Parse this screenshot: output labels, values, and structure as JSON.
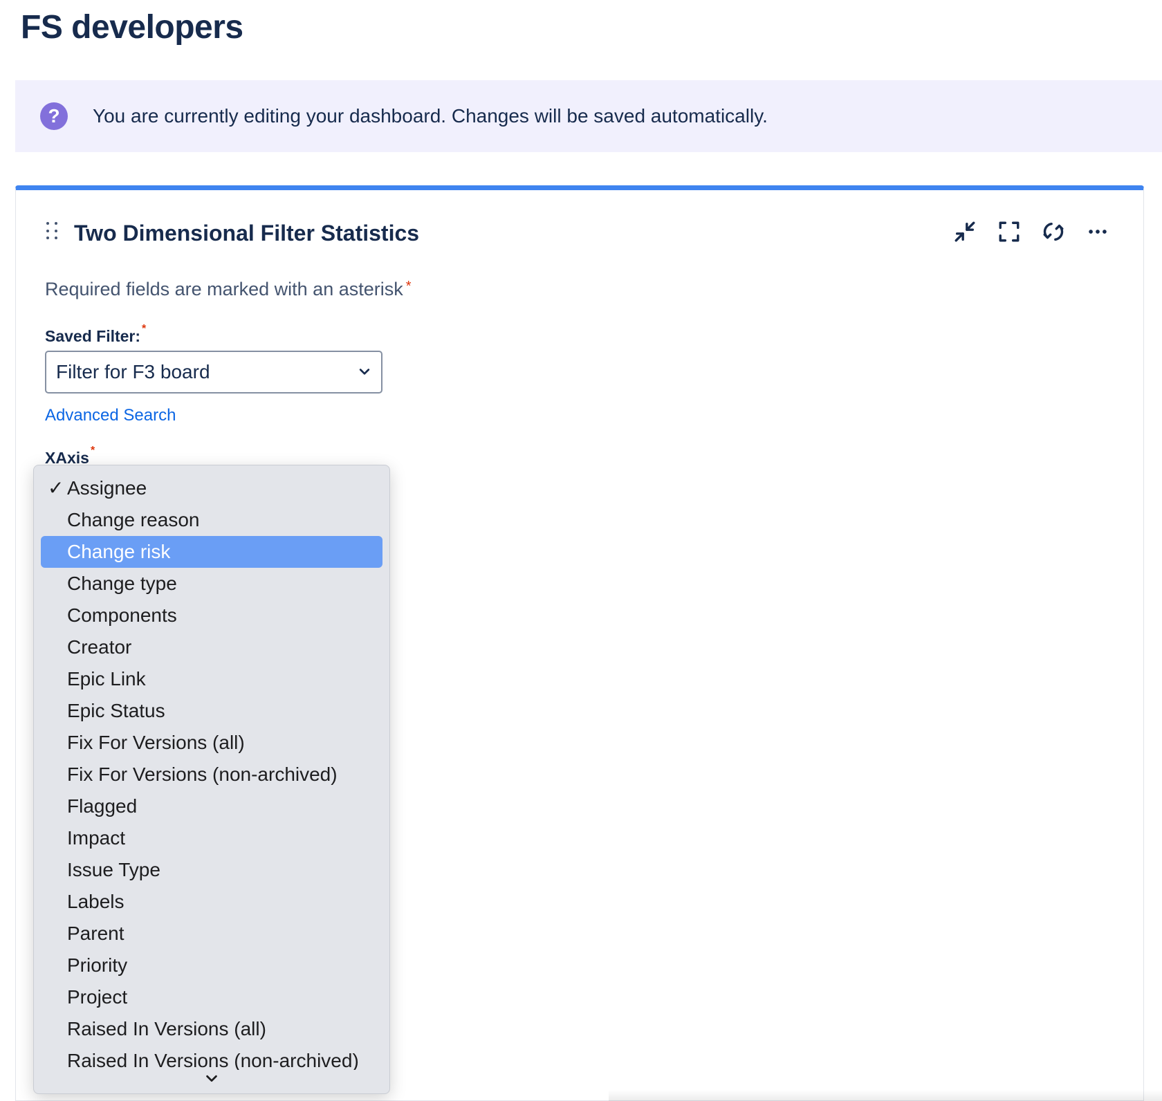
{
  "page": {
    "title": "FS developers"
  },
  "banner": {
    "icon": "question-icon",
    "icon_glyph": "?",
    "text": "You are currently editing your dashboard. Changes will be saved automatically."
  },
  "gadget": {
    "title": "Two Dimensional Filter Statistics",
    "actions": [
      "minimize-icon",
      "fullscreen-icon",
      "refresh-icon",
      "more-icon"
    ],
    "required_note": "Required fields are marked with an asterisk",
    "asterisk": "*",
    "saved_filter": {
      "label": "Saved Filter:",
      "value": "Filter for F3 board",
      "link": "Advanced Search"
    },
    "xaxis": {
      "label": "XAxis",
      "selected": "Assignee",
      "highlighted": "Change risk",
      "check_glyph": "✓",
      "options": [
        "Assignee",
        "Change reason",
        "Change risk",
        "Change type",
        "Components",
        "Creator",
        "Epic Link",
        "Epic Status",
        "Fix For Versions (all)",
        "Fix For Versions (non-archived)",
        "Flagged",
        "Impact",
        "Issue Type",
        "Labels",
        "Parent",
        "Priority",
        "Project",
        "Raised In Versions (all)",
        "Raised In Versions (non-archived)"
      ]
    }
  },
  "colors": {
    "accent": "#3f84f0",
    "banner_bg": "#f1f0fd",
    "banner_icon": "#8270db",
    "link": "#0c66e4",
    "highlight": "#6a9ef5",
    "required": "#de350b"
  }
}
